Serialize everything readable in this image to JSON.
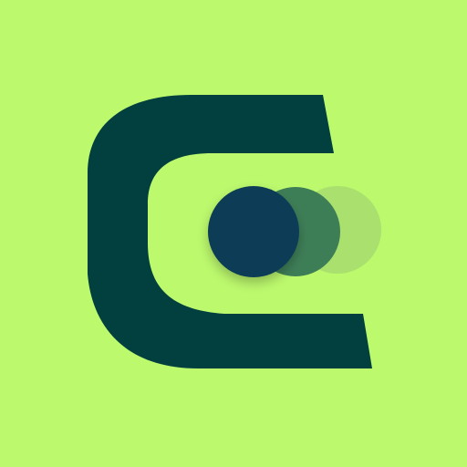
{
  "icon": {
    "name": "app-logo",
    "description_tokens": [
      "c-shape",
      "circles"
    ],
    "colors": {
      "background": "#BCF96D",
      "c_shape": "#023F3F",
      "circle_front": "#0A3C57",
      "circle_middle": "#3E7E57",
      "circle_back": "#A6DC6F"
    },
    "circle_back_opacity": 0.85,
    "circle_middle_opacity": 1
  }
}
